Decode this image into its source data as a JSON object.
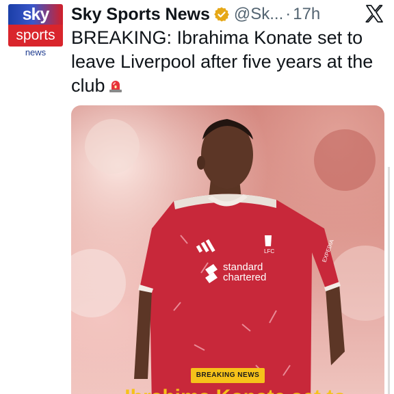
{
  "account": {
    "logo": {
      "line1": "sky",
      "line2": "sports",
      "line3": "news"
    },
    "name": "Sky Sports News",
    "verified_icon": "verified-badge-gold",
    "handle": "@Sk...",
    "separator": "·",
    "time": "17h"
  },
  "header": {
    "platform_icon": "x-logo-icon"
  },
  "tweet": {
    "text": "BREAKING: Ibrahima Konate set to leave Liverpool after five years at the club",
    "emoji_icon": "rotating-light-icon"
  },
  "media": {
    "jersey_text": {
      "sponsor_line1": "standard",
      "sponsor_line2": "chartered",
      "club": "LFC",
      "sleeve": "EXPEDIA"
    },
    "badge": "BREAKING NEWS",
    "headline_peek": "Ibrahima Konate set to"
  },
  "colors": {
    "sky_blue": "#1b3fa8",
    "sky_red": "#d9252c",
    "verified_gold": "#e6a817",
    "shirt_red": "#c8283a",
    "badge_yellow": "#f6c21a"
  }
}
